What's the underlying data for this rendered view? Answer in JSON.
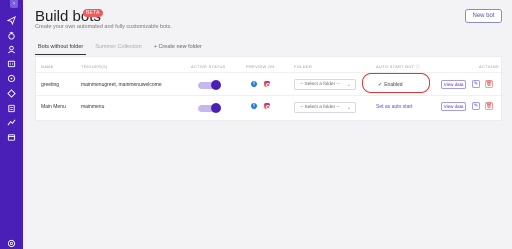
{
  "sidebar": {
    "collapse_icon": "chevron-right-icon",
    "items": [
      {
        "icon": "send-icon"
      },
      {
        "icon": "puzzle-icon"
      },
      {
        "icon": "user-icon"
      },
      {
        "icon": "bot-icon"
      },
      {
        "icon": "stack-icon"
      },
      {
        "icon": "broadcast-icon"
      },
      {
        "icon": "settings-icon"
      },
      {
        "icon": "chart-icon"
      },
      {
        "icon": "billing-icon"
      },
      {
        "icon": "help-icon"
      }
    ]
  },
  "header": {
    "title": "Build bots",
    "badge": "BETA",
    "subtitle": "Create your own automated and fully customizable bots.",
    "new_bot_label": "New bot"
  },
  "tabs": [
    {
      "label": "Bots without folder",
      "active": true
    },
    {
      "label": "Summer Collection",
      "active": false
    },
    {
      "label": "+ Create new folder",
      "active": false
    }
  ],
  "table": {
    "headers": {
      "name": "NAME",
      "triggers": "TRIGGER(S)",
      "active_status": "ACTIVE STATUS",
      "preview_on": "PREVIEW ON",
      "folder": "FOLDER",
      "auto_start": "AUTO START BOT",
      "actions": "ACTIONS"
    },
    "rows": [
      {
        "name": "greeting",
        "triggers": "mainmenugreet, mainmenuwelcome",
        "active": true,
        "folder_placeholder": "-- Select a folder --",
        "auto_start": "Enabled",
        "view_label": "View data"
      },
      {
        "name": "Main Menu",
        "triggers": "mainmenu",
        "active": true,
        "folder_placeholder": "-- Select a folder --",
        "auto_start": "Set as auto start",
        "view_label": "View data"
      }
    ]
  },
  "colors": {
    "sidebar": "#4a1fb8",
    "accent": "#4a1fb8",
    "badge": "#ef5a5a",
    "highlight": "#e03535"
  }
}
